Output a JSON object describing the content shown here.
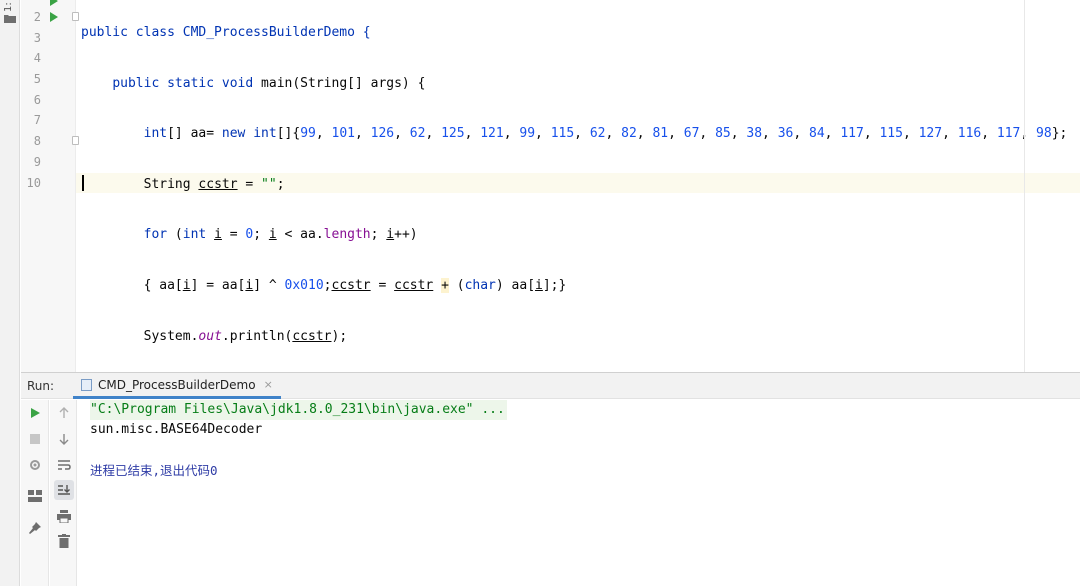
{
  "tool_strip": {
    "project_tab": "1:"
  },
  "editor": {
    "line_numbers": [
      "2",
      "3",
      "4",
      "5",
      "6",
      "7",
      "8",
      "9",
      "10"
    ],
    "top_line_partial": "public class CMD_ProcessBuilderDemo {",
    "line2": {
      "kw1": "public",
      "kw2": "static",
      "kw3": "void",
      "name": "main(String[] args) {"
    },
    "line3": {
      "kw_int": "int",
      "arr_decl": "[] aa= ",
      "kw_new": "new",
      "kw_int2": "int",
      "brace": "[]{",
      "values": [
        "99",
        "101",
        "126",
        "62",
        "125",
        "121",
        "99",
        "115",
        "62",
        "82",
        "81",
        "67",
        "85",
        "38",
        "36",
        "84",
        "117",
        "115",
        "127",
        "116",
        "117",
        "98"
      ],
      "end": "};"
    },
    "line4": {
      "type": "String ",
      "var": "ccstr",
      "eq": " = ",
      "str": "\"\"",
      "end": ";"
    },
    "line5": {
      "kw_for": "for",
      "p1": " (",
      "kw_int": "int",
      "sp": " ",
      "i1": "i",
      "p2": " = ",
      "zero": "0",
      "p3": "; ",
      "i2": "i",
      "p4": " < aa.",
      "length": "length",
      "p5": "; ",
      "i3": "i",
      "p6": "++)"
    },
    "line6": {
      "p1": "{ aa[",
      "i1": "i",
      "p2": "] = aa[",
      "i2": "i",
      "p3": "] ^ ",
      "hex": "0x010",
      "p4": ";",
      "v1": "ccstr",
      "p5": " = ",
      "v2": "ccstr",
      "p6": " ",
      "plus": "+",
      "p7": " (",
      "kw_char": "char",
      "p8": ") aa[",
      "i3": "i",
      "p9": "];}"
    },
    "line7": {
      "p1": "System.",
      "out": "out",
      "p2": ".println(",
      "var": "ccstr",
      "p3": ");"
    },
    "line8": "}",
    "line9": "}"
  },
  "run_window": {
    "label": "Run:",
    "tab_label": "CMD_ProcessBuilderDemo",
    "tab_close": "×",
    "toolbar_icons": [
      "run-icon",
      "stop-icon",
      "debug-settings-icon",
      "layout-icon",
      "pin-icon",
      "arrow-up-icon",
      "arrow-down-icon",
      "soft-wrap-icon",
      "scroll-to-end-icon",
      "print-icon",
      "trash-icon"
    ],
    "console": {
      "command": "\"C:\\Program Files\\Java\\jdk1.8.0_231\\bin\\java.exe\" ...",
      "output": "sun.misc.BASE64Decoder",
      "exit": "进程已结束,退出代码0"
    }
  },
  "colors": {
    "keyword": "#0033b3",
    "number": "#1750eb",
    "string": "#067d17",
    "field": "#871094",
    "run_green": "#3aa345",
    "tab_underline": "#4083c9"
  }
}
